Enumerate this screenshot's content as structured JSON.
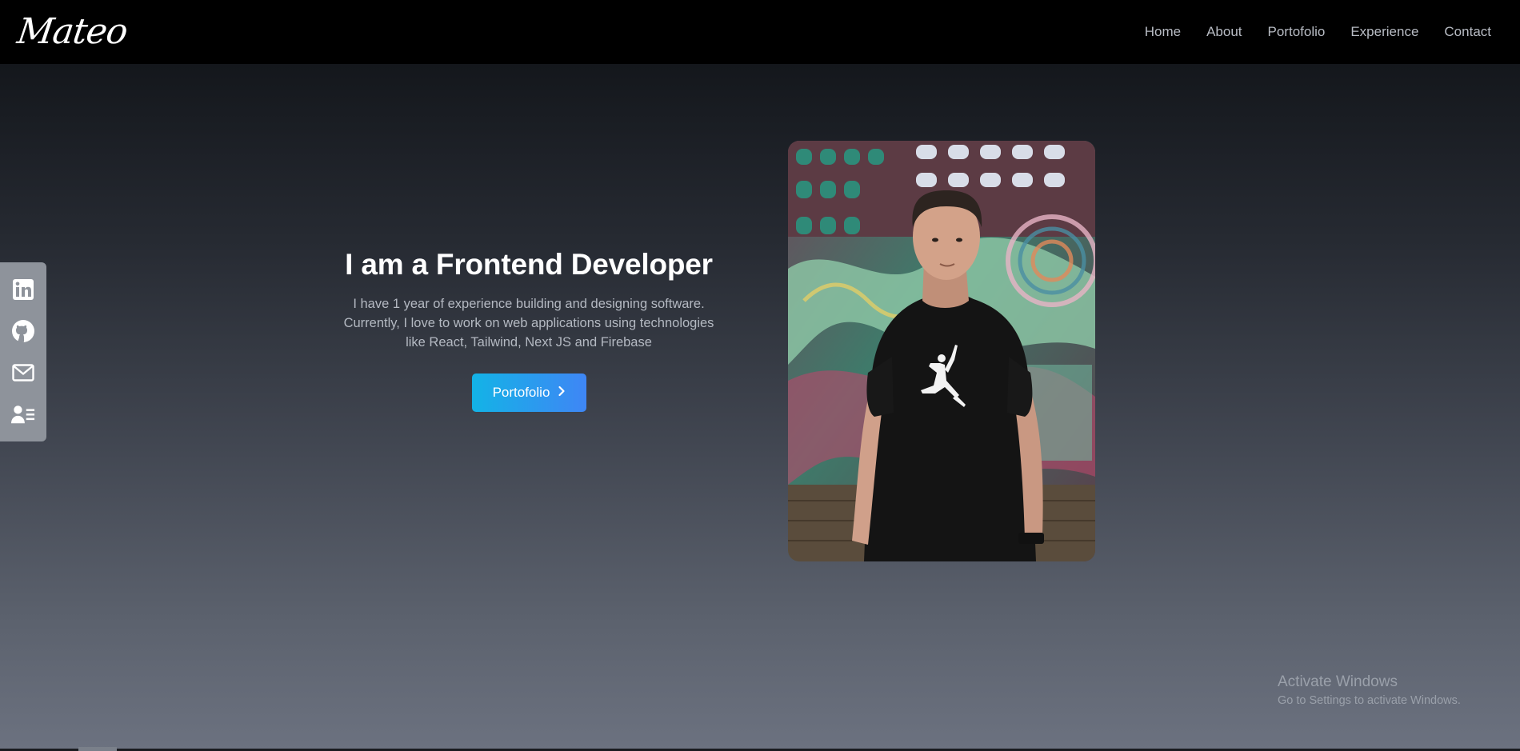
{
  "header": {
    "logo_text": "Mateo",
    "nav": [
      {
        "label": "Home"
      },
      {
        "label": "About"
      },
      {
        "label": "Portofolio"
      },
      {
        "label": "Experience"
      },
      {
        "label": "Contact"
      }
    ]
  },
  "social": [
    {
      "icon": "linkedin-icon"
    },
    {
      "icon": "github-icon"
    },
    {
      "icon": "mail-icon"
    },
    {
      "icon": "resume-icon"
    }
  ],
  "hero": {
    "title": "I am a Frontend Developer",
    "description": "I have 1 year of experience building and designing software. Currently, I love to work on web applications using technologies like React, Tailwind, Next JS and Firebase",
    "button_label": "Portofolio",
    "button_icon": "chevron-right-icon"
  },
  "watermark": {
    "title": "Activate Windows",
    "subtitle": "Go to Settings to activate Windows."
  },
  "colors": {
    "navbar": "#000000",
    "button_start": "#13b3e6",
    "button_end": "#3f86f5",
    "social_bar": "#8e939b"
  }
}
